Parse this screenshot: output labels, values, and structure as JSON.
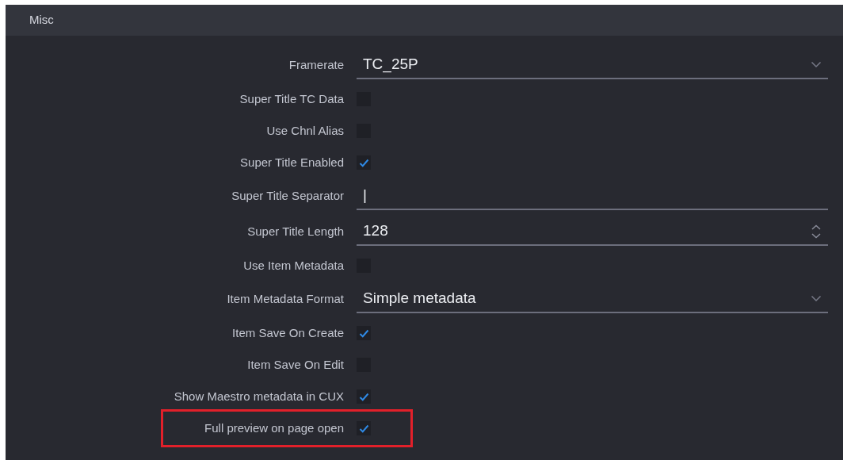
{
  "panel": {
    "title": "Misc"
  },
  "rows": [
    {
      "kind": "select",
      "label": "Framerate",
      "value": "TC_25P",
      "highlighted": false
    },
    {
      "kind": "checkbox",
      "label": "Super Title TC Data",
      "checked": false,
      "highlighted": false
    },
    {
      "kind": "checkbox",
      "label": "Use Chnl Alias",
      "checked": false,
      "highlighted": false
    },
    {
      "kind": "checkbox",
      "label": "Super Title Enabled",
      "checked": true,
      "highlighted": false
    },
    {
      "kind": "text",
      "label": "Super Title Separator",
      "value": "|",
      "highlighted": false
    },
    {
      "kind": "number",
      "label": "Super Title Length",
      "value": "128",
      "highlighted": false
    },
    {
      "kind": "checkbox",
      "label": "Use Item Metadata",
      "checked": false,
      "highlighted": false
    },
    {
      "kind": "select",
      "label": "Item Metadata Format",
      "value": "Simple metadata",
      "highlighted": false
    },
    {
      "kind": "checkbox",
      "label": "Item Save On Create",
      "checked": true,
      "highlighted": false
    },
    {
      "kind": "checkbox",
      "label": "Item Save On Edit",
      "checked": false,
      "highlighted": false
    },
    {
      "kind": "checkbox",
      "label": "Show Maestro metadata in CUX",
      "checked": true,
      "highlighted": false
    },
    {
      "kind": "checkbox",
      "label": "Full preview on page open",
      "checked": true,
      "highlighted": true
    }
  ]
}
